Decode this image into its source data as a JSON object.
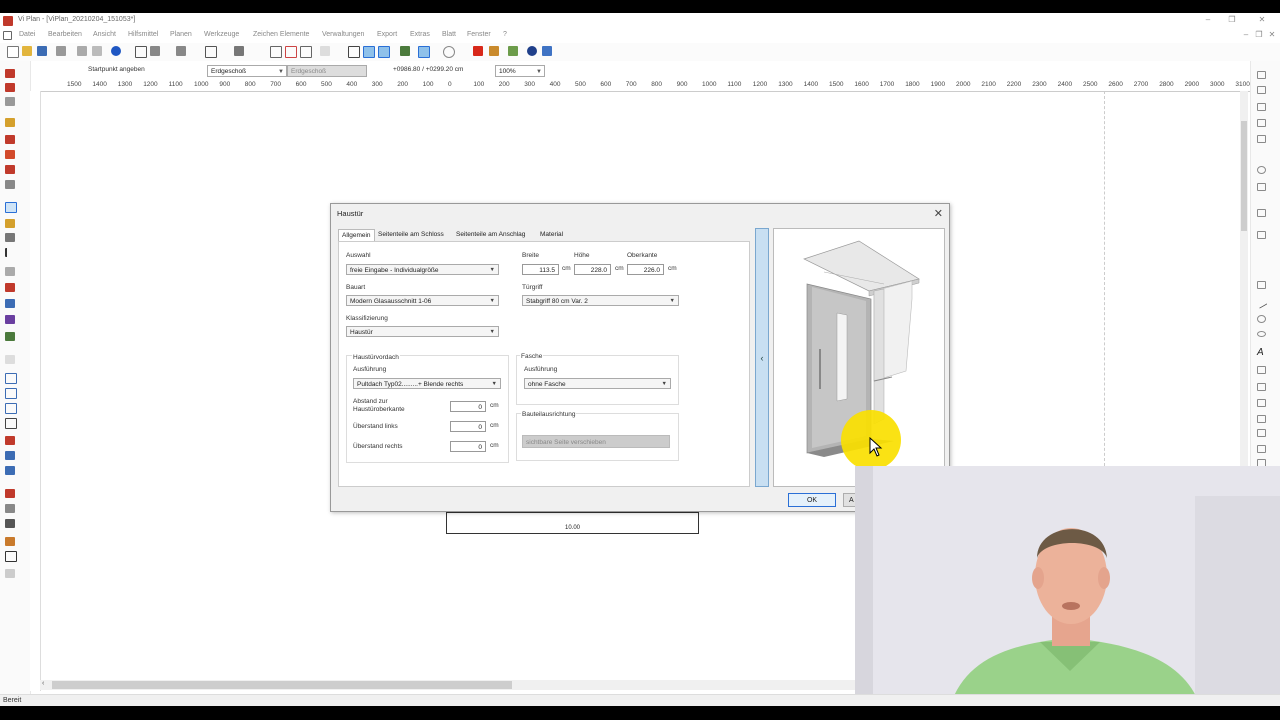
{
  "window": {
    "title": "Vi Plan - [ViPlan_20210204_151053*]",
    "controls": [
      "–",
      "❐",
      "✕"
    ]
  },
  "menu": [
    "Datei",
    "Bearbeiten",
    "Ansicht",
    "Hilfsmittel",
    "Planen",
    "Werkzeuge",
    "Zeichen Elemente",
    "Verwaltungen",
    "Export",
    "Extras",
    "Blatt",
    "Fenster",
    "?"
  ],
  "infobar": {
    "hint": "Startpunkt angeben",
    "floor_combo": "Erdgeschoß",
    "floor_field": "Erdgeschoß",
    "coords": "+0986.80 / +0299.20 cm",
    "zoom": "100%"
  },
  "ruler_labels": [
    "1500",
    "1400",
    "1300",
    "1200",
    "1100",
    "1000",
    "900",
    "800",
    "700",
    "600",
    "500",
    "400",
    "300",
    "200",
    "100",
    "0",
    "100",
    "200",
    "300",
    "400",
    "500",
    "600",
    "700",
    "800",
    "900",
    "1000",
    "1100",
    "1200",
    "1300",
    "1400",
    "1500",
    "1600",
    "1700",
    "1800",
    "1900",
    "2000",
    "2100",
    "2200",
    "2300",
    "2400",
    "2500",
    "2600",
    "2700",
    "2800",
    "2900",
    "3000",
    "3100"
  ],
  "plan": {
    "dimension_label": "10.00"
  },
  "dialog": {
    "title": "Haustür",
    "close": "✕",
    "tabs": [
      "Allgemein",
      "Seitenteile am Schloss",
      "Seitenteile am Anschlag",
      "Material"
    ],
    "auswahl": {
      "label": "Auswahl",
      "value": "freie Eingabe - Individualgröße"
    },
    "bauart": {
      "label": "Bauart",
      "value": "Modern Glasausschnitt 1-06"
    },
    "klassifizierung": {
      "label": "Klassifizierung",
      "value": "Haustür"
    },
    "breite": {
      "label": "Breite",
      "value": "113.5",
      "unit": "cm"
    },
    "hoehe": {
      "label": "Höhe",
      "value": "228.0",
      "unit": "cm"
    },
    "oberkante": {
      "label": "Oberkante",
      "value": "226.0",
      "unit": "cm"
    },
    "tuergriff": {
      "label": "Türgriff",
      "value": "Stabgriff 80 cm Var. 2"
    },
    "vordach": {
      "group": "Haustürvordach",
      "ausfuehrung_label": "Ausführung",
      "ausfuehrung_value": "Pultdach Typ02.........+ Blende rechts",
      "abstand_label": "Abstand zur Haustüroberkante",
      "abstand_value": "0",
      "ueberstand_links_label": "Überstand links",
      "ueberstand_links_value": "0",
      "ueberstand_rechts_label": "Überstand rechts",
      "ueberstand_rechts_value": "0",
      "unit": "cm"
    },
    "fasche": {
      "group": "Fasche",
      "ausfuehrung_label": "Ausführung",
      "ausfuehrung_value": "ohne Fasche"
    },
    "bauteil": {
      "group": "Bauteilausrichtung",
      "button": "sichtbare Seite verschieben"
    },
    "collapse_arrow": "‹",
    "ok": "OK",
    "cancel": "A"
  },
  "status": "Bereit",
  "colors": {
    "accent": "#2a6fd6",
    "highlight": "#fae000",
    "collapse": "#c8dff2"
  }
}
